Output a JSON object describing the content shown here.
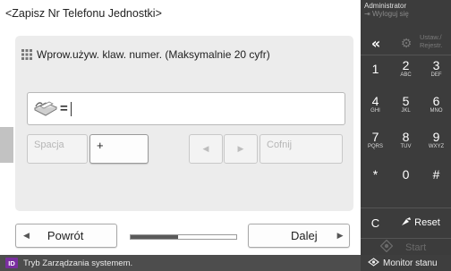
{
  "screen": {
    "title": "<Zapisz Nr Telefonu Jednostki>",
    "panel_header": "Wprow.używ. klaw. numer. (Maksymalnie 20 cyfr)",
    "input": {
      "prefix": "=",
      "value": ""
    },
    "keys": {
      "space": "Spacja",
      "plus": "+",
      "backspace": "Cofnij"
    },
    "navigation": {
      "back": "Powrót",
      "next": "Dalej",
      "progress": 0.45
    }
  },
  "side_panel": {
    "user": "Administrator",
    "logout": "Wyloguj się",
    "settings_line1": "Ustaw./",
    "settings_line2": "Rejestr.",
    "keypad": [
      {
        "digit": "1",
        "letters": ""
      },
      {
        "digit": "2",
        "letters": "ABC"
      },
      {
        "digit": "3",
        "letters": "DEF"
      },
      {
        "digit": "4",
        "letters": "GHI"
      },
      {
        "digit": "5",
        "letters": "JKL"
      },
      {
        "digit": "6",
        "letters": "MNO"
      },
      {
        "digit": "7",
        "letters": "PQRS"
      },
      {
        "digit": "8",
        "letters": "TUV"
      },
      {
        "digit": "9",
        "letters": "WXYZ"
      },
      {
        "digit": "*",
        "letters": ""
      },
      {
        "digit": "0",
        "letters": ""
      },
      {
        "digit": "#",
        "letters": ""
      }
    ],
    "clear": "C",
    "reset": "Reset",
    "start": "Start"
  },
  "status_bar": {
    "badge": "ID",
    "message": "Tryb Zarządzania systemem.",
    "monitor": "Monitor stanu"
  },
  "colors": {
    "panel": "#ececec",
    "side_panel": "#3c3c3c",
    "status_bar": "#4d4d4d",
    "id_badge": "#7a2ea0"
  },
  "icons": [
    "fax-icon",
    "keypad-icon",
    "collapse-icon",
    "gear-icon",
    "start-icon",
    "monitor-icon"
  ]
}
